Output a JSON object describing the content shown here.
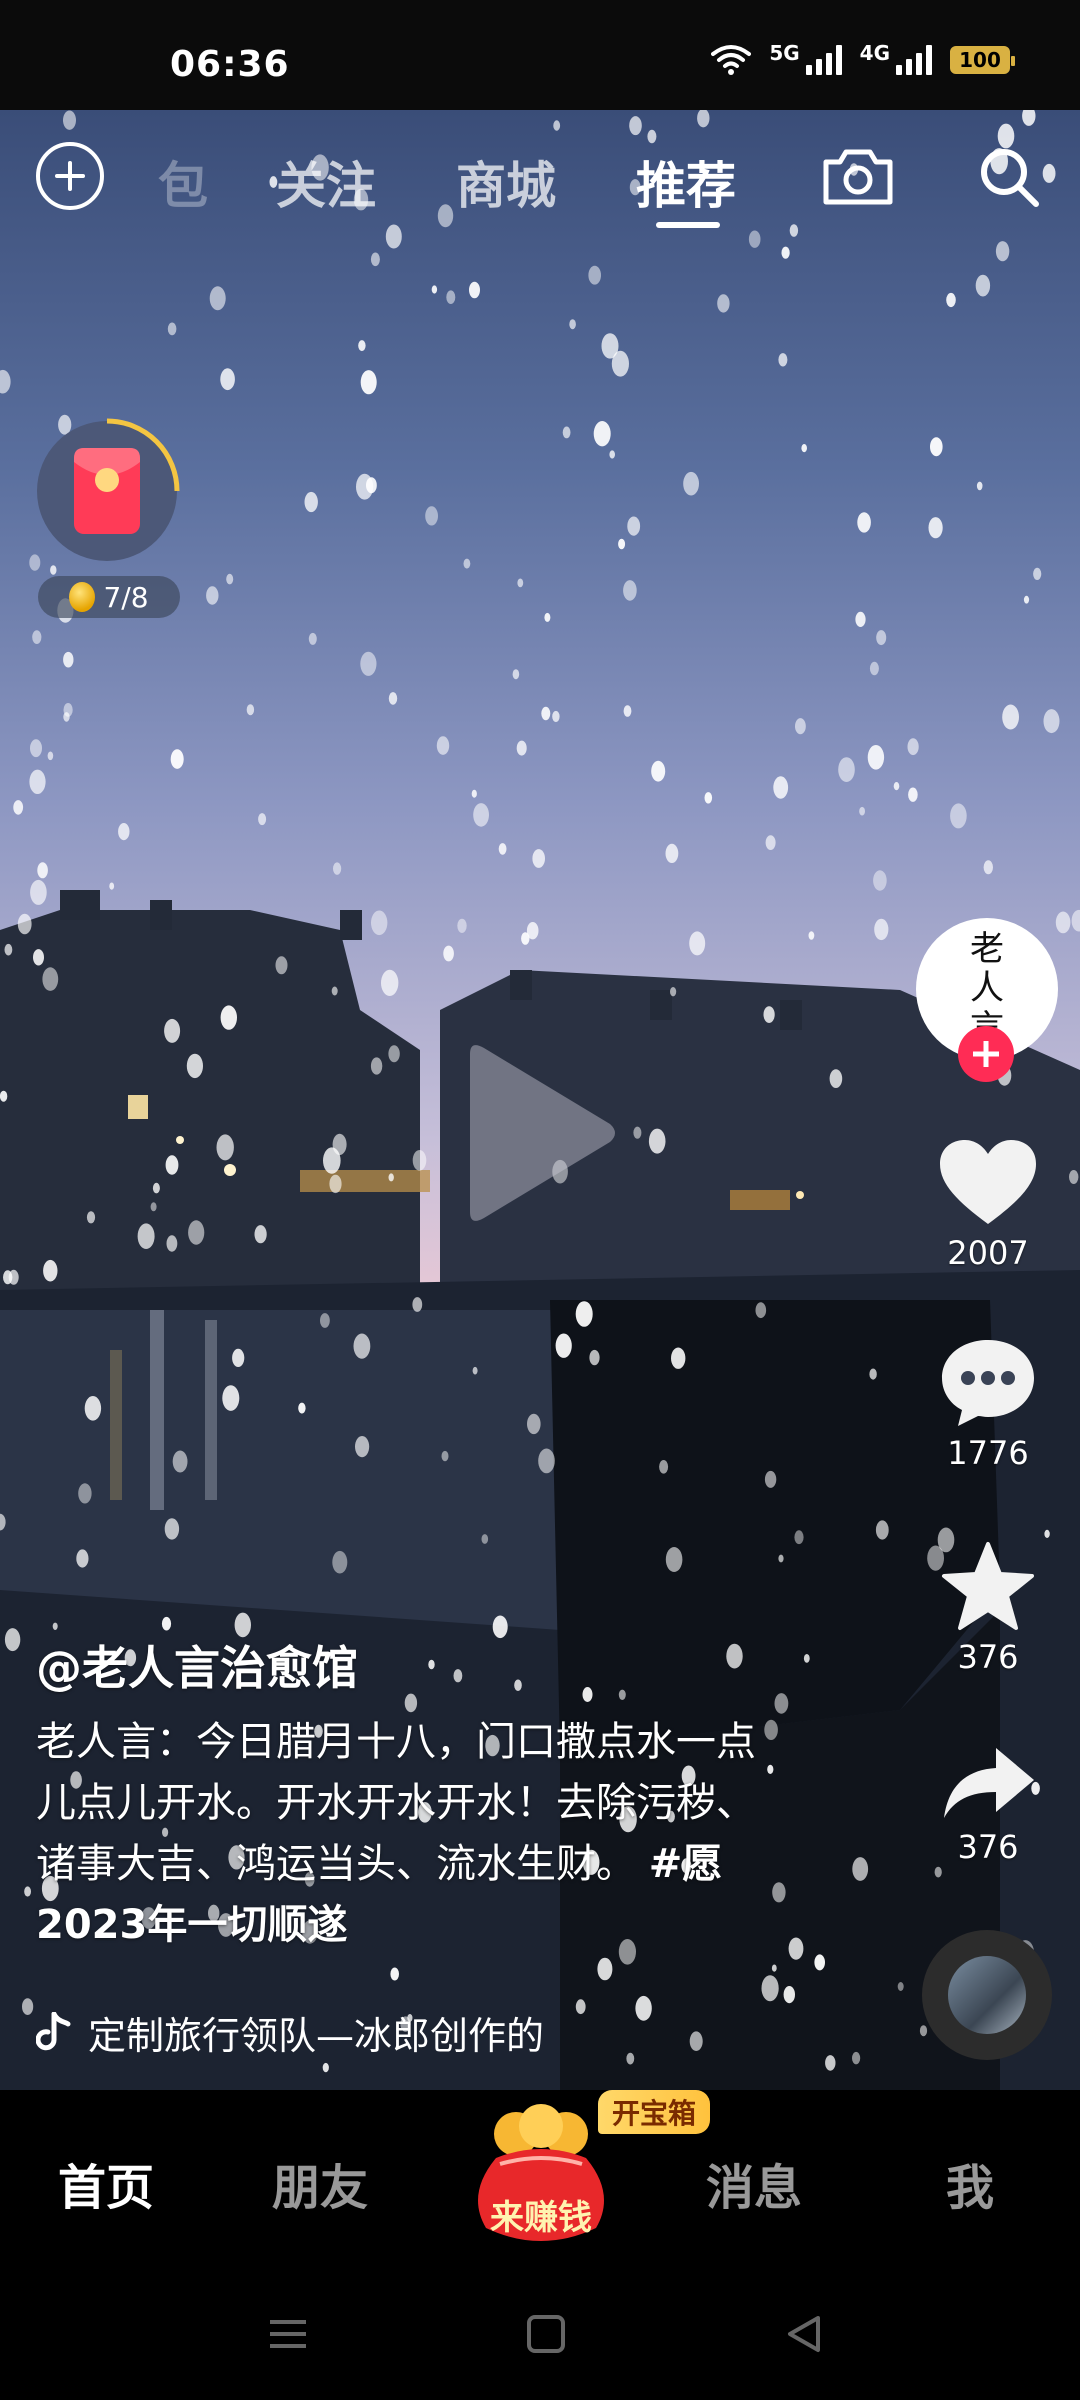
{
  "status_bar": {
    "time": "06:36",
    "net1": "5G",
    "net2": "4G",
    "battery": "100"
  },
  "top_nav": {
    "tabs": [
      {
        "label": "包",
        "state": "faded"
      },
      {
        "label": "关注",
        "state": "normal"
      },
      {
        "label": "商城",
        "state": "normal"
      },
      {
        "label": "推荐",
        "state": "active"
      }
    ]
  },
  "red_packet": {
    "progress": "7/8"
  },
  "post": {
    "author": "@老人言治愈馆",
    "description": "老人言：今日腊月十八，门口撒点水一点儿点儿开水。开水开水开水！去除污秽、诸事大吉、鸿运当头、流水生财。",
    "hashtag": "#愿2023年一切顺遂",
    "music": "定制旅行领队—冰郎创作的"
  },
  "creator_avatar": {
    "line1": "老",
    "line2": "人",
    "line3": "言"
  },
  "actions": {
    "likes": "2007",
    "comments": "1776",
    "favorites": "376",
    "shares": "376"
  },
  "bottom_nav": {
    "home": "首页",
    "friends": "朋友",
    "earn": "来赚钱",
    "treasure_badge": "开宝箱",
    "messages": "消息",
    "me": "我"
  },
  "colors": {
    "accent_red": "#ff2c55",
    "battery": "#d9b142",
    "earn_red": "#e8282a"
  }
}
